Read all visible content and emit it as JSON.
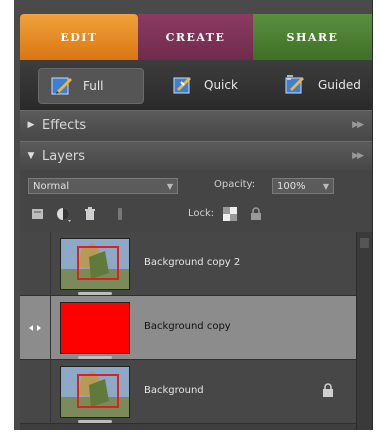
{
  "tabs": [
    {
      "label": "EDIT",
      "active": true,
      "color": "#e98a24"
    },
    {
      "label": "CREATE",
      "active": false,
      "color": "#7c3358"
    },
    {
      "label": "SHARE",
      "active": false,
      "color": "#4d8334"
    }
  ],
  "modes": [
    {
      "label": "Full",
      "active": true,
      "icon": "full-edit-icon"
    },
    {
      "label": "Quick",
      "active": false,
      "icon": "quick-fix-icon"
    },
    {
      "label": "Guided",
      "active": false,
      "icon": "guided-edit-icon"
    }
  ],
  "sections": {
    "effects": {
      "label": "Effects",
      "expanded": false
    },
    "layers": {
      "label": "Layers",
      "expanded": true
    }
  },
  "layer_controls": {
    "blend_mode": "Normal",
    "opacity_label": "Opacity:",
    "opacity_value": "100%",
    "lock_label": "Lock:"
  },
  "layers": [
    {
      "name": "Background copy 2",
      "selected": false,
      "visible": false,
      "thumb": "photo",
      "locked": false
    },
    {
      "name": "Background copy",
      "selected": true,
      "visible": true,
      "thumb": "red-fill",
      "locked": false
    },
    {
      "name": "Background",
      "selected": false,
      "visible": false,
      "thumb": "photo",
      "locked": true
    }
  ],
  "colors": {
    "selected_row": "#8c8c8c",
    "red_fill": "#ff0000"
  }
}
